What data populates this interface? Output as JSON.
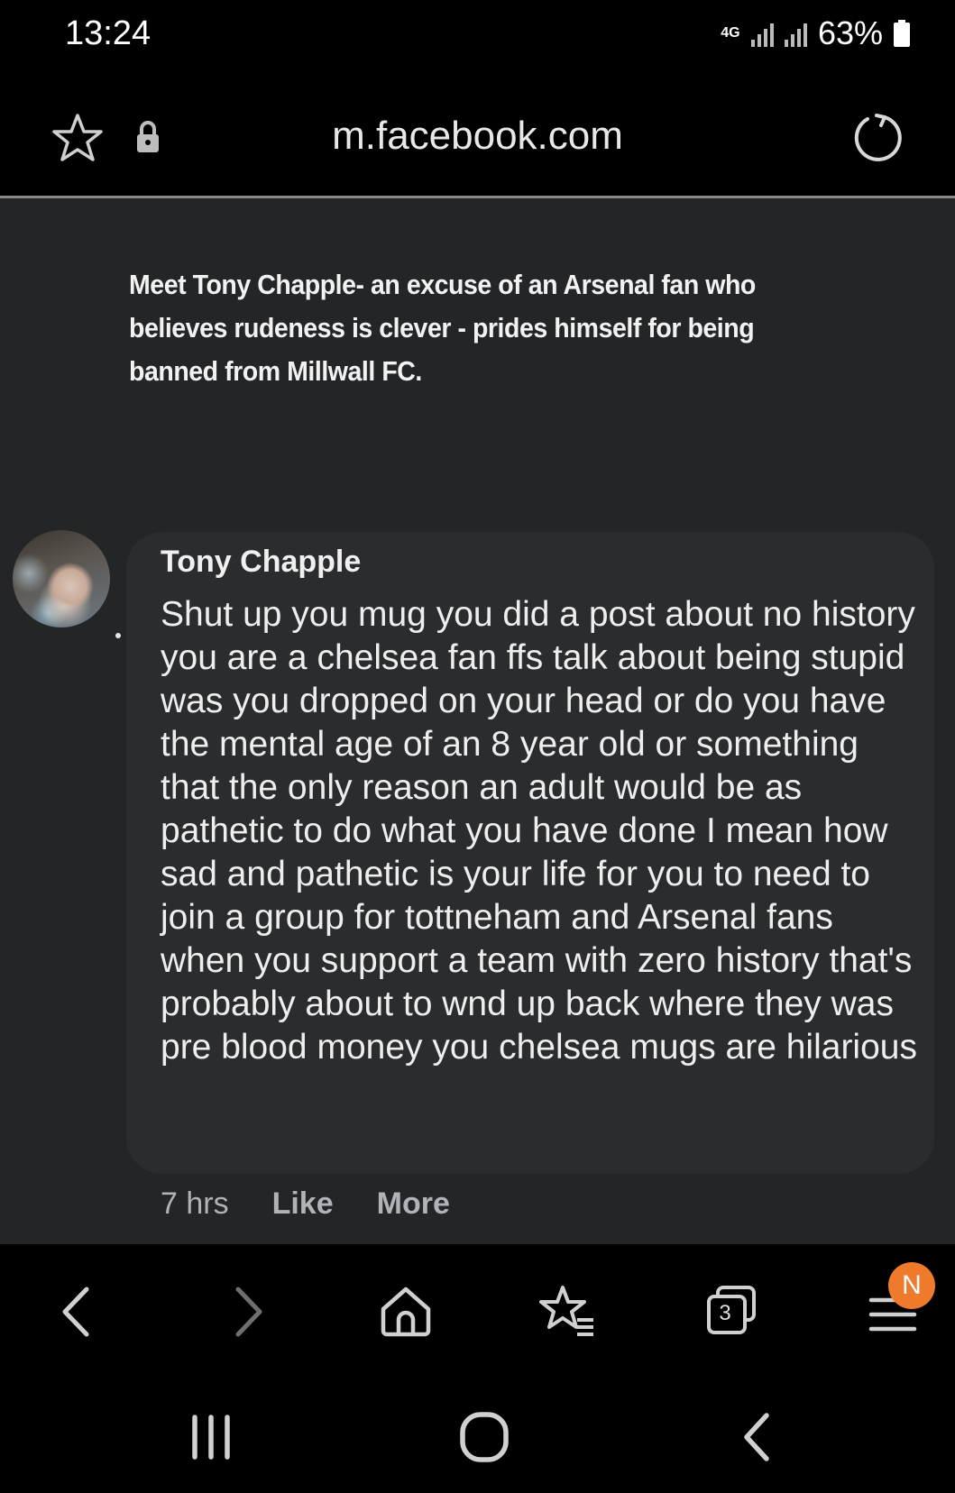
{
  "status": {
    "time": "13:24",
    "network": "4G",
    "battery": "63%"
  },
  "browser": {
    "url": "m.facebook.com",
    "tab_count": "3",
    "notification_badge": "N"
  },
  "post": {
    "caption": "Meet Tony Chapple- an excuse of an Arsenal fan who believes rudeness is clever - prides himself for being banned from Millwall FC."
  },
  "comment": {
    "author": "Tony Chapple",
    "text": "Shut up you mug you did a post about no history you are a chelsea fan ffs talk about being stupid was you dropped on your head or do you have the mental age of an 8 year old or something that the only reason an adult would be as pathetic to do what you have done I mean how sad and pathetic is your life for you to need to join a group for tottneham and Arsenal fans when you support a team with zero history that's probably about to wnd up back where they was pre blood money you chelsea mugs are hilarious",
    "time": "7 hrs",
    "like_label": "Like",
    "more_label": "More"
  },
  "icons": [
    "star-icon",
    "lock-icon",
    "reload-icon",
    "back-icon",
    "forward-icon",
    "home-icon",
    "bookmarks-icon",
    "tabs-icon",
    "menu-icon",
    "recents-icon",
    "home-system-icon",
    "back-system-icon"
  ]
}
